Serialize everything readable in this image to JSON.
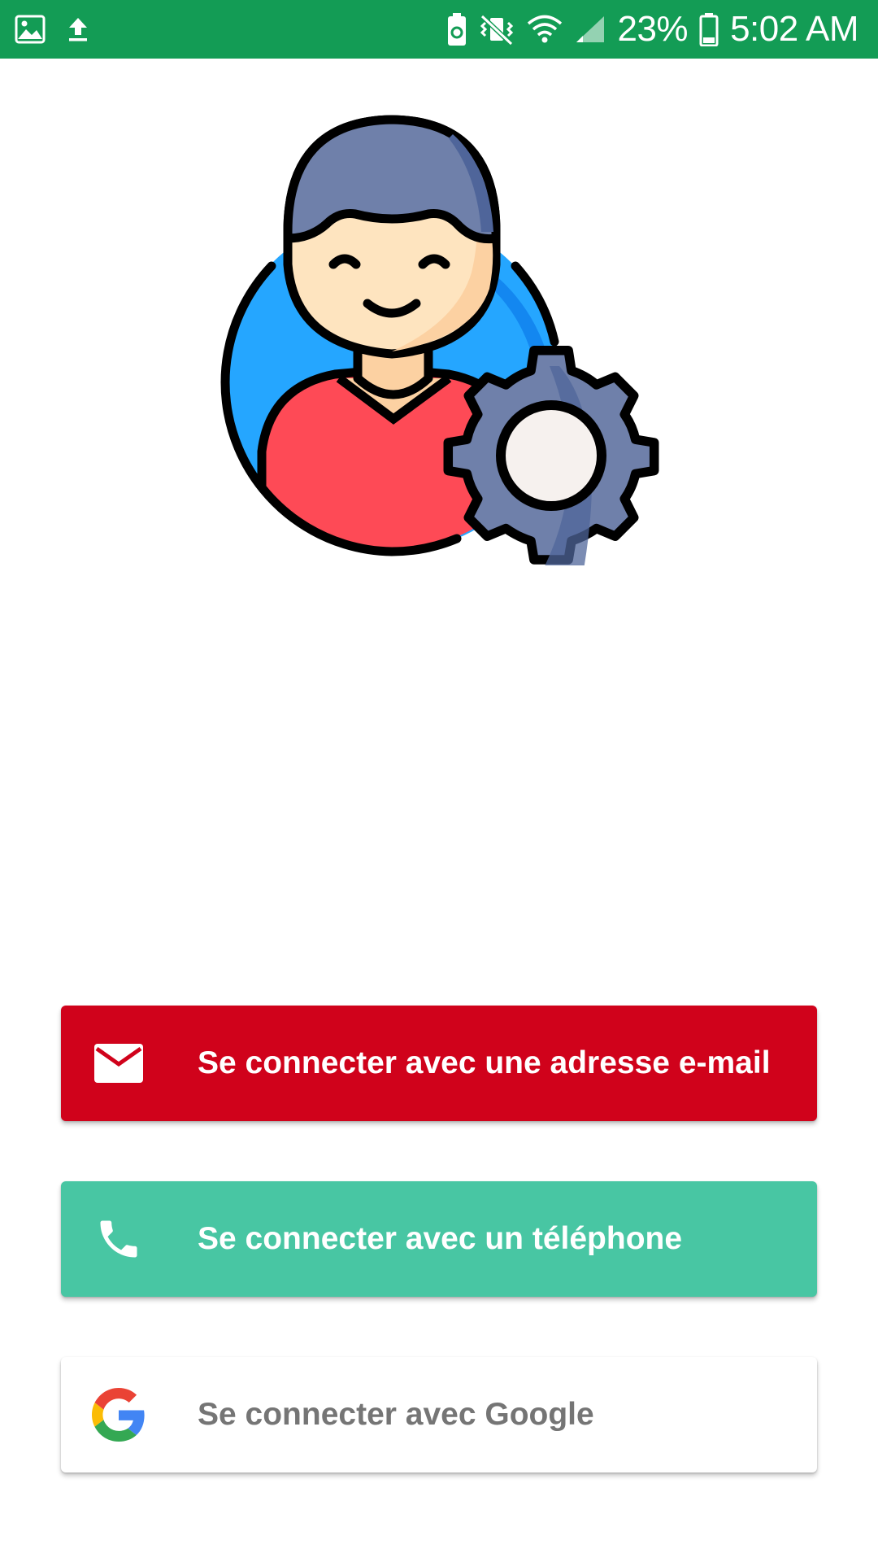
{
  "status_bar": {
    "battery_percent": "23%",
    "time": "5:02 AM",
    "icons": [
      "image-icon",
      "upload-icon",
      "battery-saver-icon",
      "vibrate-mute-icon",
      "wifi-icon",
      "signal-icon",
      "battery-icon"
    ]
  },
  "hero": {
    "icon": "user-settings-illustration",
    "colors": {
      "circle": "#25a6ff",
      "hair": "#6f80aa",
      "skin": "#fee4bf",
      "shirt": "#fe4a56",
      "gear": "#6f80aa",
      "gear_center": "#f6f1ee"
    }
  },
  "buttons": {
    "email": {
      "label": "Se connecter avec une adresse e-mail",
      "icon": "mail-icon",
      "color": "#d0021b"
    },
    "phone": {
      "label": "Se connecter avec un téléphone",
      "icon": "phone-icon",
      "color": "#48c6a3"
    },
    "google": {
      "label": "Se connecter avec Google",
      "icon": "google-icon",
      "color": "#ffffff"
    }
  },
  "theme": {
    "status_bar": "#139c55"
  }
}
